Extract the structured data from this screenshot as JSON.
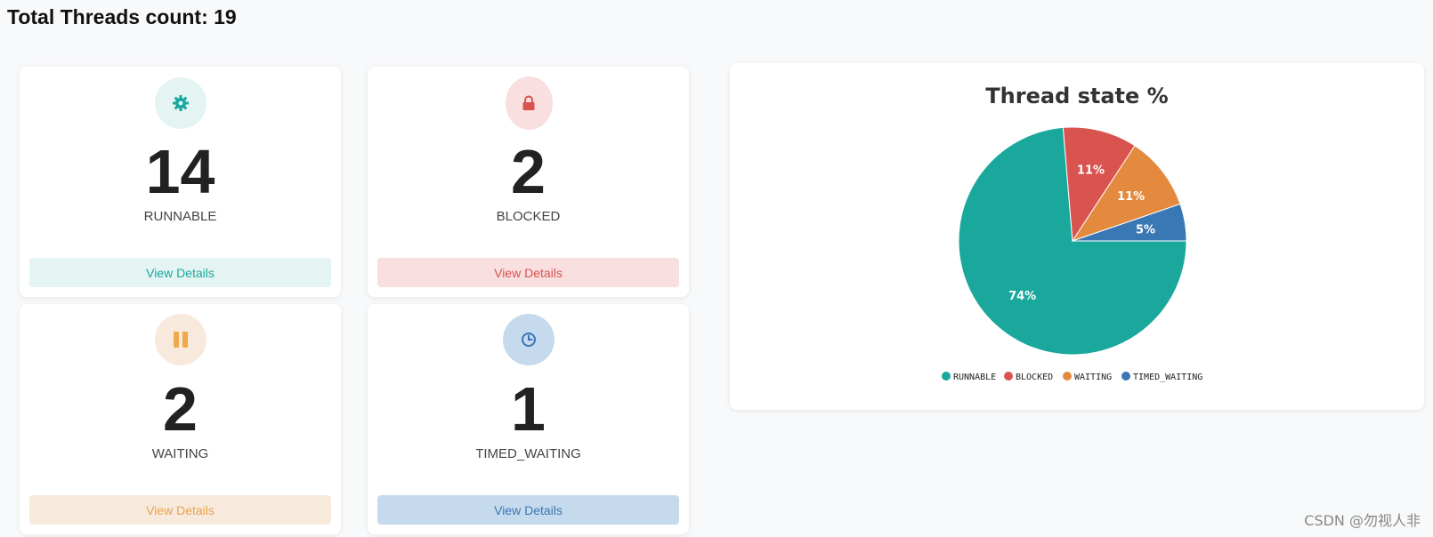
{
  "header": {
    "title": "Total Threads count: 19"
  },
  "cards": [
    {
      "icon": "gear-icon",
      "count": "14",
      "label": "RUNNABLE",
      "button": "View Details",
      "color": "#1aa89c",
      "tint": "#e3f4f3"
    },
    {
      "icon": "lock-icon",
      "count": "2",
      "label": "BLOCKED",
      "button": "View Details",
      "color": "#d9534f",
      "tint": "#f9dfdf"
    },
    {
      "icon": "pause-icon",
      "count": "2",
      "label": "WAITING",
      "button": "View Details",
      "color": "#e8a44a",
      "tint": "#f8e9dd"
    },
    {
      "icon": "clock-icon",
      "count": "1",
      "label": "TIMED_WAITING",
      "button": "View Details",
      "color": "#3a77b5",
      "tint": "#c5daec"
    }
  ],
  "chart_data": {
    "type": "pie",
    "title": "Thread state %",
    "categories": [
      "RUNNABLE",
      "BLOCKED",
      "WAITING",
      "TIMED_WAITING"
    ],
    "values": [
      14,
      2,
      2,
      1
    ],
    "labels": [
      "74%",
      "11%",
      "11%",
      "5%"
    ],
    "colors": [
      "#1aa89c",
      "#d9534f",
      "#e48a3e",
      "#3a77b5"
    ],
    "legend_position": "bottom"
  },
  "watermark": "CSDN @勿视人非"
}
